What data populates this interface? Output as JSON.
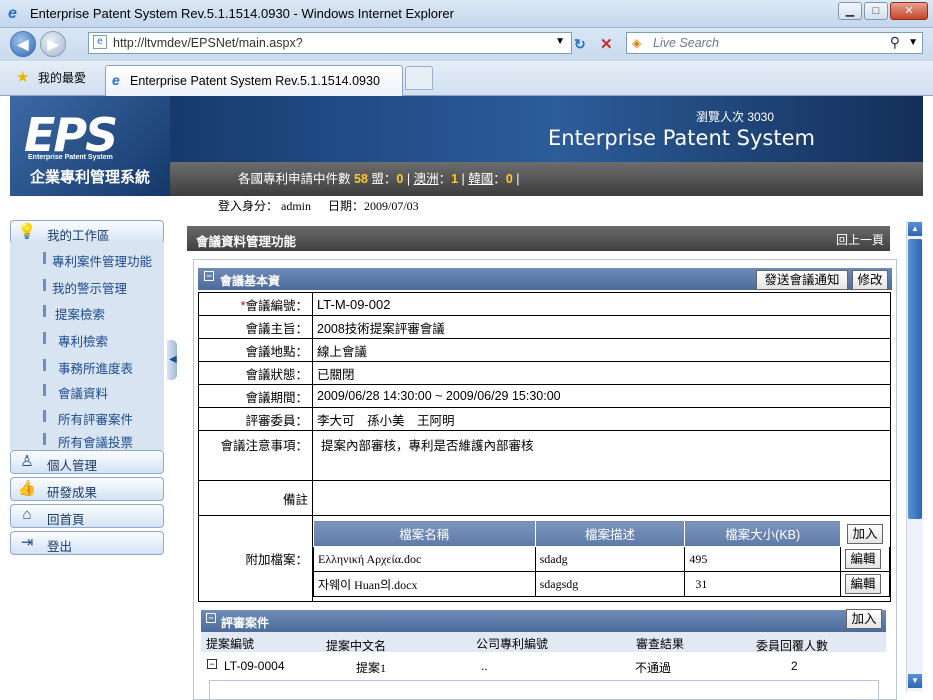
{
  "window": {
    "title": "Enterprise Patent System Rev.5.1.1514.0930 - Windows Internet Explorer"
  },
  "browser": {
    "address": "http://ltvmdev/EPSNet/main.aspx?",
    "search_placeholder": "Live Search",
    "favorites": "我的最愛",
    "tab_title": "Enterprise Patent System Rev.5.1.1514.0930"
  },
  "header": {
    "logo": "EPS",
    "logo_sub": "Enterprise Patent System",
    "logo_cn": "企業專利管理系統",
    "visits": "瀏覽人次 3030",
    "system_name": "Enterprise Patent System",
    "stats": {
      "label": "各國專利申請中件數",
      "total": "58",
      "jp": "盟：",
      "jp_n": "0",
      "au": "澳洲",
      "au_n": "1",
      "kr": "韓國",
      "kr_n": "0"
    },
    "login": "登入身分： admin",
    "date": "日期：2009/07/03"
  },
  "sidebar": {
    "work": "我的工作區",
    "items": [
      "專利案件管理功能",
      "我的警示管理",
      "提案檢索",
      "專利檢索",
      "事務所進度表",
      "會議資料",
      "所有評審案件",
      "所有會議投票"
    ],
    "personal": "個人管理",
    "results": "研發成果",
    "home": "回首頁",
    "logout": "登出"
  },
  "page": {
    "title": "會議資料管理功能",
    "back": "回上一頁"
  },
  "meeting": {
    "section": "會議基本資",
    "notify_btn": "發送會議通知",
    "edit_btn": "修改",
    "rows": [
      {
        "label": "會議編號",
        "value": "LT-M-09-002"
      },
      {
        "label": "會議主旨",
        "value": "2008技術提案評審會議"
      },
      {
        "label": "會議地點",
        "value": "線上會議"
      },
      {
        "label": "會議狀態",
        "value": "已關閉"
      },
      {
        "label": "會議期間",
        "value": "2009/06/28 14:30:00 ~ 2009/06/29 15:30:00"
      },
      {
        "label": "評審委員",
        "value": "李大可　孫小美　王阿明"
      }
    ],
    "notes_label": "會議注意事項：",
    "notes": "提案內部審核，專利是否維護內部審核",
    "remark_label": "備註",
    "attach_label": "附加檔案：",
    "files_headers": [
      "檔案名稱",
      "檔案描述",
      "檔案大小(KB)"
    ],
    "add_btn": "加入",
    "files": [
      {
        "name": "Ελληνική Αρχεία.doc",
        "desc": "sdadg",
        "size": "495",
        "btn": "編輯"
      },
      {
        "name": "자웨이 Huan의.docx",
        "desc": "sdagsdg",
        "size": "31",
        "btn": "編輯"
      }
    ]
  },
  "review": {
    "section": "評審案件",
    "add_btn": "加入",
    "headers": [
      "提案編號",
      "提案中文名",
      "公司專利編號",
      "審查結果",
      "委員回覆人數"
    ],
    "rows": [
      {
        "no": "LT-09-0004",
        "name": "提案1",
        "pid": "..",
        "result": "不通過",
        "count": "2"
      }
    ]
  }
}
